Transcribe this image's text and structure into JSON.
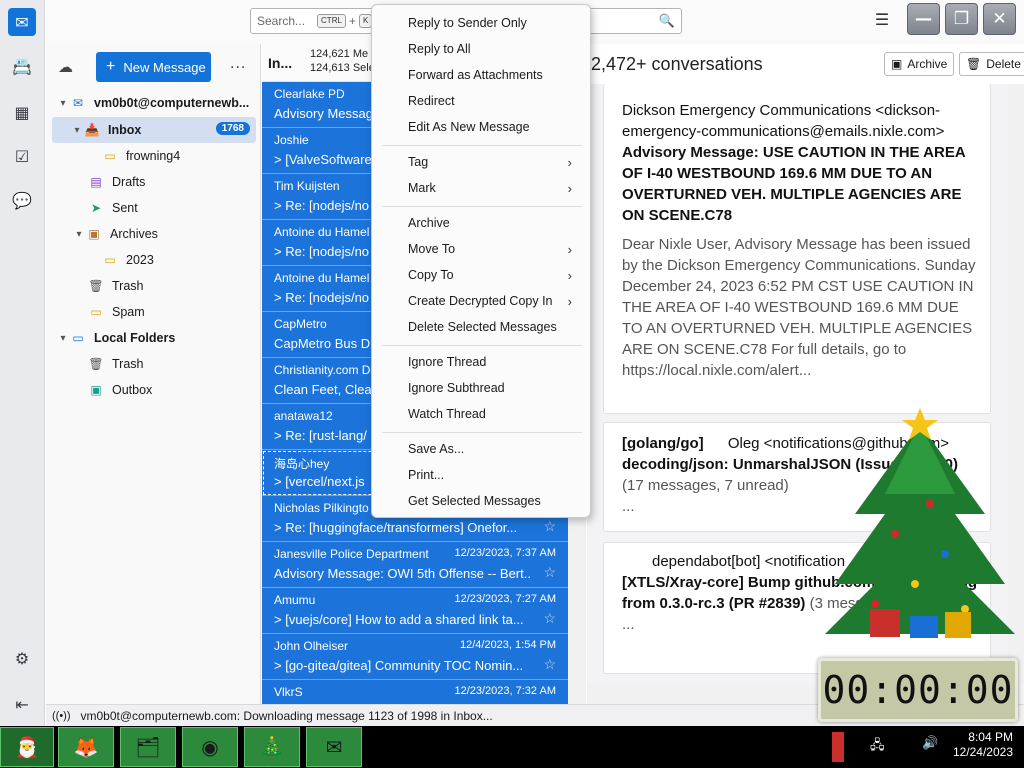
{
  "header": {
    "search_placeholder": "Search...",
    "kbd_ctrl": "CTRL",
    "kbd_plus": "+",
    "kbd_k": "K"
  },
  "folder_pane": {
    "new_message": "New Message",
    "more": "...",
    "folders": [
      {
        "label": "vm0b0t@computernewb...",
        "bold": true
      },
      {
        "label": "Inbox",
        "count": "1768"
      },
      {
        "label": "frowning4"
      },
      {
        "label": "Drafts"
      },
      {
        "label": "Sent"
      },
      {
        "label": "Archives"
      },
      {
        "label": "2023"
      },
      {
        "label": "Trash"
      },
      {
        "label": "Spam"
      },
      {
        "label": "Local Folders",
        "bold": true
      },
      {
        "label": "Trash"
      },
      {
        "label": "Outbox"
      }
    ]
  },
  "thread_pane": {
    "folder": "In...",
    "count_messages": "124,621 Me",
    "count_selected": "124,613 Sele",
    "rows": [
      {
        "from": "Clearlake PD",
        "date": "",
        "subject": "Advisory Message"
      },
      {
        "from": "Joshie",
        "date": "",
        "subject": "> [ValveSoftware"
      },
      {
        "from": "Tim Kuijsten",
        "date": "",
        "subject": "> Re: [nodejs/no"
      },
      {
        "from": "Antoine du Hamel",
        "date": "",
        "subject": "> Re: [nodejs/no"
      },
      {
        "from": "Antoine du Hamel",
        "date": "",
        "subject": "> Re: [nodejs/no"
      },
      {
        "from": "CapMetro",
        "date": "",
        "subject": "CapMetro Bus D"
      },
      {
        "from": "Christianity.com D",
        "date": "",
        "subject": "Clean Feet, Clear"
      },
      {
        "from": "anatawa12",
        "date": "",
        "subject": "> Re: [rust-lang/"
      },
      {
        "from": "海岛心hey",
        "date": "",
        "subject": "> [vercel/next.js"
      },
      {
        "from": "Nicholas Pilkingto",
        "date": "",
        "subject": "> Re: [huggingface/transformers] Onefor..."
      },
      {
        "from": "Janesville Police Department",
        "date": "12/23/2023, 7:37 AM",
        "subject": "Advisory Message: OWI 5th Offense -- Bert..."
      },
      {
        "from": "Amumu",
        "date": "12/23/2023, 7:27 AM",
        "subject": "> [vuejs/core] How to add a shared link ta..."
      },
      {
        "from": "John Olheiser",
        "date": "12/4/2023, 1:54 PM",
        "subject": "> [go-gitea/gitea] Community TOC Nomin..."
      },
      {
        "from": "VlkrS",
        "date": "12/23/2023, 7:32 AM",
        "subject": ""
      }
    ]
  },
  "message_pane": {
    "title": "2,472+ conversations",
    "archive": "Archive",
    "delete": "Delete",
    "card1": {
      "from": "Dickson Emergency Communications <dickson-emergency-communications@emails.nixle.com>",
      "subject": "Advisory Message: USE CAUTION IN THE AREA OF I-40 WESTBOUND 169.6 MM DUE TO AN OVERTURNED VEH. MULTIPLE AGENCIES ARE ON SCENE.C78",
      "body": "Dear Nixle User, Advisory Message has been issued by the Dickson Emergency Communications. Sunday December 24, 2023 6:52 PM CST USE CAUTION IN THE AREA OF I-40 WESTBOUND 169.6 MM DUE TO AN OVERTURNED VEH. MULTIPLE AGENCIES ARE ON SCENE.C78 For full details, go to https://local.nixle.com/alert..."
    },
    "card2": {
      "from_prefix": "[golang/go]",
      "from": "Oleg <notifications@github.com>",
      "subject": "decoding/json: UnmarshalJSON (Issue #64850)",
      "meta": "(17 messages, 7 unread)",
      "ellipsis": "..."
    },
    "card3": {
      "from": "dependabot[bot] <notification",
      "subject": "[XTLS/Xray-core] Bump github.com/sagernet/sing from 0.3.0-rc.3 (PR #2839)",
      "meta": "(3 messages,",
      "ellipsis": "..."
    }
  },
  "status": "vm0b0t@computernewb.com: Downloading message 1123 of 1998 in Inbox...",
  "context_menu": [
    {
      "label": "Reply to Sender Only"
    },
    {
      "label": "Reply to All"
    },
    {
      "label": "Forward as Attachments"
    },
    {
      "label": "Redirect"
    },
    {
      "label": "Edit As New Message"
    },
    {
      "label": "Tag",
      "submenu": true
    },
    {
      "label": "Mark",
      "submenu": true
    },
    {
      "label": "Archive"
    },
    {
      "label": "Move To",
      "submenu": true
    },
    {
      "label": "Copy To",
      "submenu": true
    },
    {
      "label": "Create Decrypted Copy In",
      "submenu": true
    },
    {
      "label": "Delete Selected Messages"
    },
    {
      "label": "Ignore Thread"
    },
    {
      "label": "Ignore Subthread"
    },
    {
      "label": "Watch Thread"
    },
    {
      "label": "Save As..."
    },
    {
      "label": "Print..."
    },
    {
      "label": "Get Selected Messages"
    }
  ],
  "clock": "00:00:00",
  "taskbar": {
    "time": "8:04 PM",
    "date": "12/24/2023"
  },
  "colors": {
    "accent": "#1373d9",
    "selected_row": "#1c73d9",
    "taskbar_button": "#2d8a3c"
  }
}
